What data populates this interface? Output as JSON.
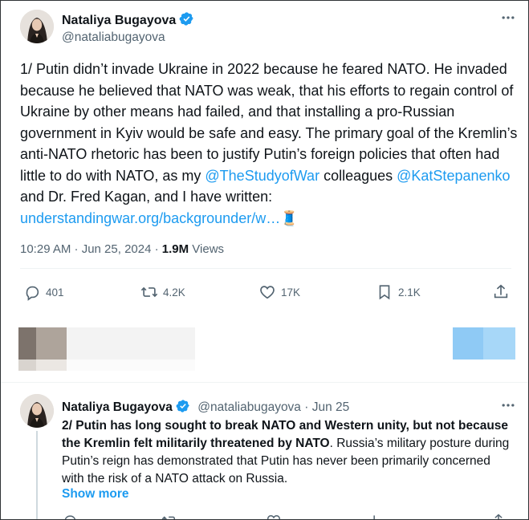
{
  "main_tweet": {
    "author_name": "Nataliya Bugayova",
    "author_handle": "@nataliabugayova",
    "text_parts": {
      "part1": "1/ Putin didn’t invade Ukraine in 2022 because he feared NATO. He invaded because he believed that NATO was weak, that his efforts to regain control of Ukraine by other means had failed, and that installing a pro-Russian government in Kyiv would be safe and easy. The primary goal of the Kremlin’s anti-NATO rhetoric has been to justify Putin’s foreign policies that often had little to do with NATO, as my ",
      "mention1": "@TheStudyofWar",
      "part2": " colleagues ",
      "mention2": "@KatStepanenko",
      "part3": " and Dr. Fred Kagan, and I have written: ",
      "url": "understandingwar.org/backgrounder/w…",
      "emoji": "🧵"
    },
    "time": "10:29 AM · Jun 25, 2024 · ",
    "views_count": "1.9M",
    "views_label": " Views",
    "actions": {
      "replies": "401",
      "reposts": "4.2K",
      "likes": "17K",
      "bookmarks": "2.1K"
    }
  },
  "reply_tweet": {
    "author_name": "Nataliya Bugayova",
    "author_handle": "@nataliabugayova",
    "date": " · Jun 25",
    "bold_text": "2/ Putin has long sought to break NATO and Western unity, but not because the Kremlin felt militarily threatened by NATO",
    "text": ". Russia’s military posture during Putin’s reign has demonstrated that Putin has never been primarily concerned with the risk of a NATO attack on Russia.",
    "show_more": "Show more"
  },
  "colors": {
    "accent": "#1d9bf0",
    "verified": "#1d9bf0",
    "secondary_text": "#536471",
    "thread_emoji": "#6a2c8f"
  }
}
